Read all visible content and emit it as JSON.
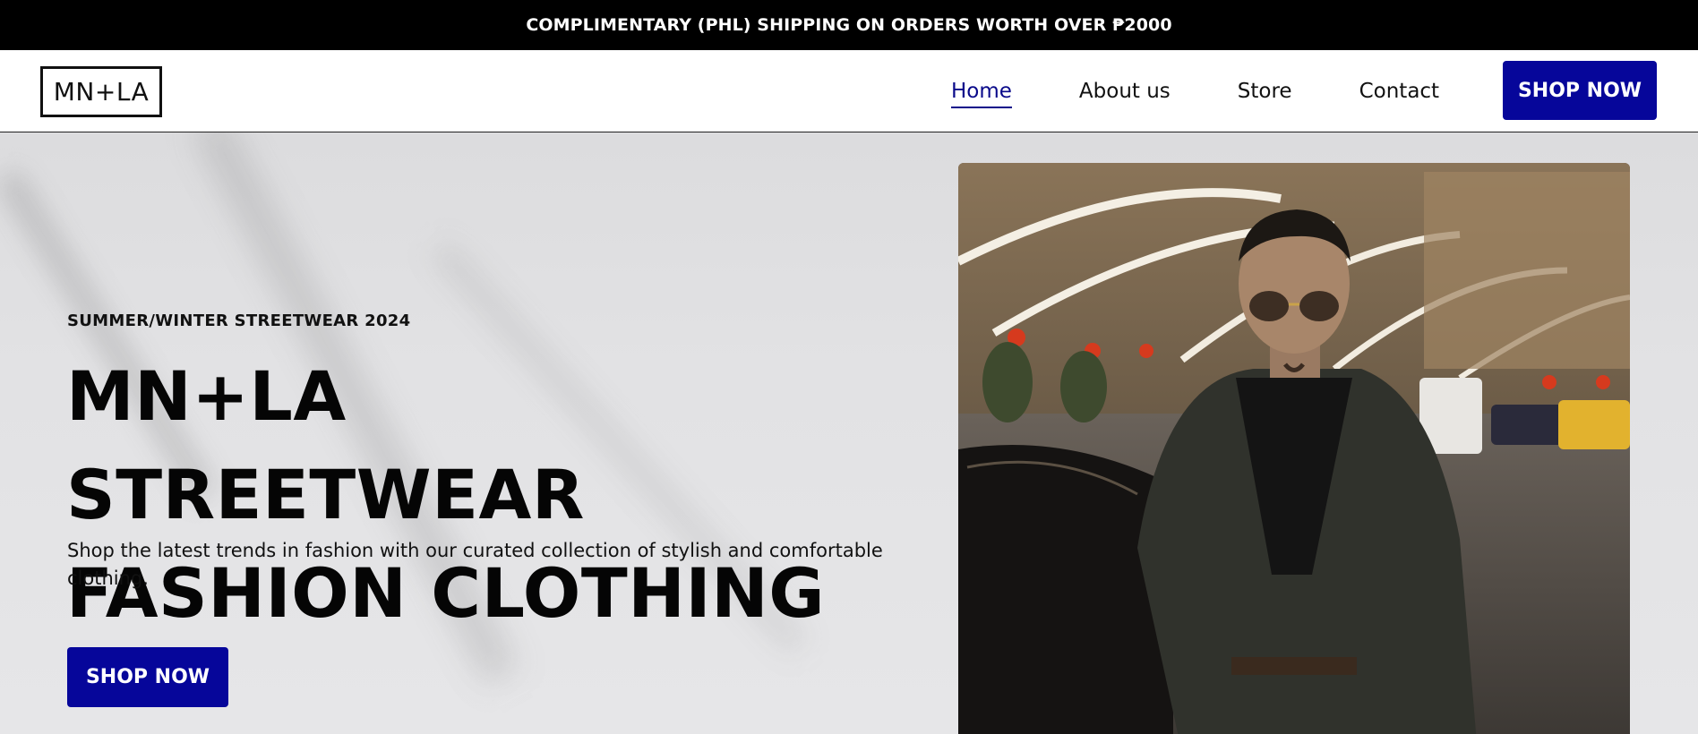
{
  "announcement": {
    "text": "COMPLIMENTARY (PHL) SHIPPING ON ORDERS WORTH OVER ₱2000"
  },
  "header": {
    "logo": "MN+LA",
    "nav": [
      {
        "label": "Home",
        "active": true
      },
      {
        "label": "About us",
        "active": false
      },
      {
        "label": "Store",
        "active": false
      },
      {
        "label": "Contact",
        "active": false
      }
    ],
    "cta_label": "SHOP NOW"
  },
  "hero": {
    "eyebrow": "SUMMER/WINTER STREETWEAR 2024",
    "headline_line1": "MN+LA STREETWEAR",
    "headline_line2": "FASHION CLOTHING",
    "description": "Shop the latest trends in fashion with our curated collection of stylish and comfortable clothing.",
    "cta_label": "SHOP NOW"
  },
  "colors": {
    "accent": "#06069a",
    "announce_bg": "#000000",
    "hero_bg": "#e2e2e4"
  }
}
